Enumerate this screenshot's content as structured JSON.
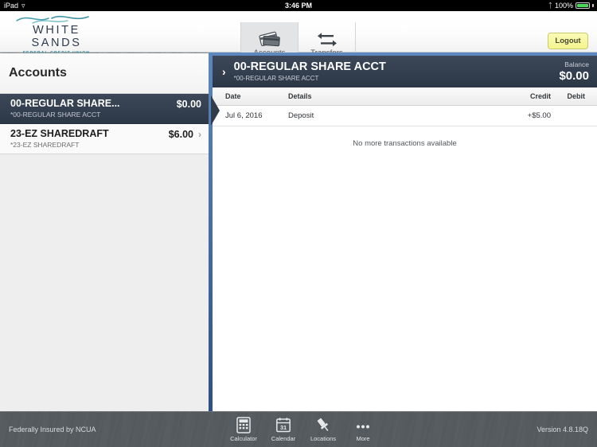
{
  "status_bar": {
    "device": "iPad",
    "wifi_icon": "wifi-icon",
    "time": "3:46 PM",
    "bluetooth_icon": "bluetooth-icon",
    "battery_percent": "100%"
  },
  "header": {
    "logo": {
      "name": "WHITE SANDS",
      "subtitle": "FEDERAL CREDIT UNION",
      "wave_color": "#4a9fae"
    },
    "tabs": [
      {
        "label": "Accounts",
        "icon": "cards-icon",
        "active": true
      },
      {
        "label": "Transfers",
        "icon": "transfer-arrows-icon",
        "active": false
      }
    ],
    "logout_label": "Logout"
  },
  "sidebar": {
    "title": "Accounts",
    "accounts": [
      {
        "name": "00-REGULAR SHARE...",
        "mask": "*00-REGULAR SHARE ACCT",
        "balance": "$0.00",
        "selected": true
      },
      {
        "name": "23-EZ SHAREDRAFT",
        "mask": "*23-EZ SHAREDRAFT",
        "balance": "$6.00",
        "selected": false
      }
    ]
  },
  "detail": {
    "chevron": "›",
    "title": "00-REGULAR SHARE ACCT",
    "mask": "*00-REGULAR SHARE ACCT",
    "balance_label": "Balance",
    "balance_amount": "$0.00",
    "columns": {
      "date": "Date",
      "details": "Details",
      "credit": "Credit",
      "debit": "Debit"
    },
    "transactions": [
      {
        "date": "Jul 6, 2016",
        "details": "Deposit",
        "credit": "+$5.00",
        "debit": ""
      }
    ],
    "empty_message": "No more transactions available"
  },
  "footer": {
    "ncua_text": "Federally Insured by NCUA",
    "tabs": [
      {
        "label": "Calculator",
        "icon": "calculator-icon"
      },
      {
        "label": "Calendar",
        "icon": "calendar-icon",
        "day": "31"
      },
      {
        "label": "Locations",
        "icon": "map-pin-icon"
      },
      {
        "label": "More",
        "icon": "ellipsis-icon"
      }
    ],
    "version": "Version 4.8.18Q"
  },
  "colors": {
    "header_dark": "#2c3746",
    "panel_blue": "#3f67a1",
    "accent_yellow": "#f4f48f",
    "logo_teal": "#4a9fae"
  }
}
